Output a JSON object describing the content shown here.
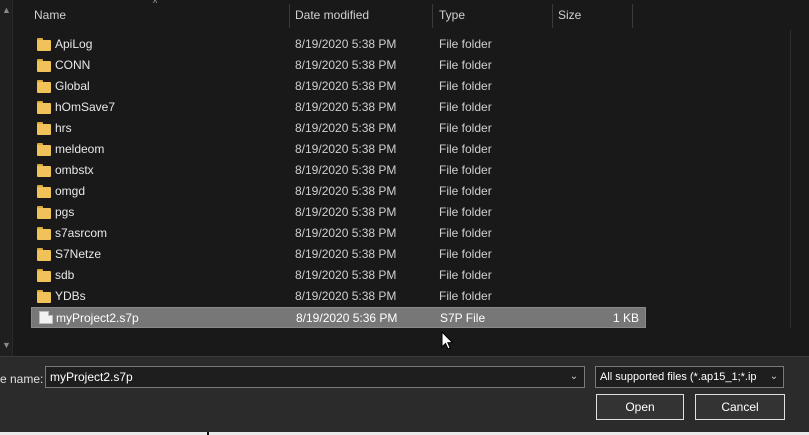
{
  "header": {
    "sort_caret": "^",
    "columns": [
      "Name",
      "Date modified",
      "Type",
      "Size"
    ]
  },
  "files": [
    {
      "name": "ApiLog",
      "date": "8/19/2020 5:38 PM",
      "type": "File folder",
      "size": "",
      "icon": "folder-icon"
    },
    {
      "name": "CONN",
      "date": "8/19/2020 5:38 PM",
      "type": "File folder",
      "size": "",
      "icon": "folder-icon"
    },
    {
      "name": "Global",
      "date": "8/19/2020 5:38 PM",
      "type": "File folder",
      "size": "",
      "icon": "folder-icon"
    },
    {
      "name": "hOmSave7",
      "date": "8/19/2020 5:38 PM",
      "type": "File folder",
      "size": "",
      "icon": "folder-icon"
    },
    {
      "name": "hrs",
      "date": "8/19/2020 5:38 PM",
      "type": "File folder",
      "size": "",
      "icon": "folder-icon"
    },
    {
      "name": "meldeom",
      "date": "8/19/2020 5:38 PM",
      "type": "File folder",
      "size": "",
      "icon": "folder-icon"
    },
    {
      "name": "ombstx",
      "date": "8/19/2020 5:38 PM",
      "type": "File folder",
      "size": "",
      "icon": "folder-icon"
    },
    {
      "name": "omgd",
      "date": "8/19/2020 5:38 PM",
      "type": "File folder",
      "size": "",
      "icon": "folder-icon"
    },
    {
      "name": "pgs",
      "date": "8/19/2020 5:38 PM",
      "type": "File folder",
      "size": "",
      "icon": "folder-icon"
    },
    {
      "name": "s7asrcom",
      "date": "8/19/2020 5:38 PM",
      "type": "File folder",
      "size": "",
      "icon": "folder-icon"
    },
    {
      "name": "S7Netze",
      "date": "8/19/2020 5:38 PM",
      "type": "File folder",
      "size": "",
      "icon": "folder-icon"
    },
    {
      "name": "sdb",
      "date": "8/19/2020 5:38 PM",
      "type": "File folder",
      "size": "",
      "icon": "folder-icon"
    },
    {
      "name": "YDBs",
      "date": "8/19/2020 5:38 PM",
      "type": "File folder",
      "size": "",
      "icon": "folder-icon"
    },
    {
      "name": "myProject2.s7p",
      "date": "8/19/2020 5:36 PM",
      "type": "S7P File",
      "size": "1 KB",
      "icon": "file-icon",
      "selected": true
    }
  ],
  "footer": {
    "file_name_label": "e name:",
    "file_name_value": "myProject2.s7p",
    "filter_value": "All supported files (*.ap15_1;*.ip",
    "open_label": "Open",
    "cancel_label": "Cancel"
  },
  "colors": {
    "background": "#191919",
    "selection": "#777777",
    "folder": "#f1c15a",
    "panel": "#2b2b2b"
  }
}
